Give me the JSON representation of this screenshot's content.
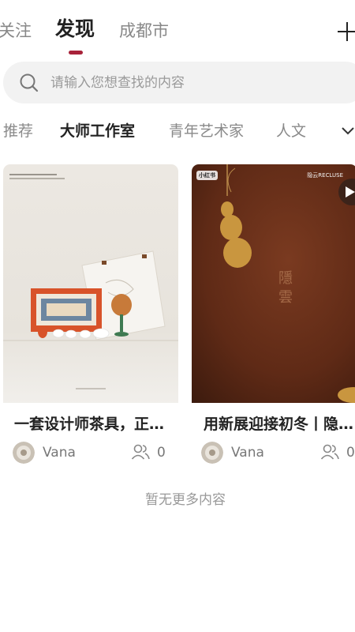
{
  "top_tabs": {
    "follow": "关注",
    "discover": "发现",
    "city": "成都市"
  },
  "search": {
    "placeholder": "请输入您想查找的内容"
  },
  "categories": [
    "推荐",
    "大师工作室",
    "青年艺术家",
    "人文"
  ],
  "cards": [
    {
      "title": "一套设计师茶具，正是冬日温暖",
      "author": "Vana",
      "likes": "0"
    },
    {
      "title": "用新展迎接初冬丨隐云 RECLUSE",
      "author": "Vana",
      "likes": "0",
      "badge": "小红书",
      "brand": "隐云RECLUSE"
    }
  ],
  "end_text": "暂无更多内容",
  "colors": {
    "accent": "#a8233a"
  }
}
